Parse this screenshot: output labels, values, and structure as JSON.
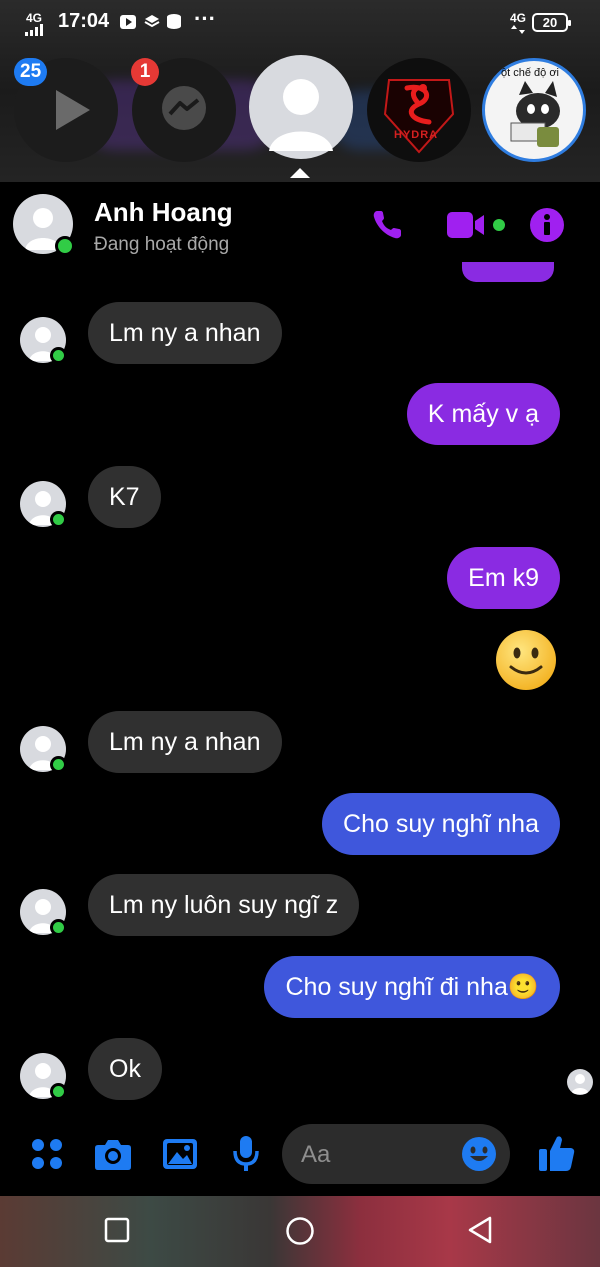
{
  "status_bar": {
    "network_left": "4G",
    "time": "17:04",
    "menu_dots": "···",
    "network_right": "4G",
    "battery": "20"
  },
  "chat_heads": {
    "badge_first": "25",
    "badge_second": "1",
    "hydra_text": "HYDRA",
    "sticker_text": "ột chế độ ơi"
  },
  "header": {
    "name": "Anh Hoang",
    "status": "Đang hoạt động",
    "accent_color": "#a020f0"
  },
  "messages": [
    {
      "side": "in",
      "text": "Lm ny a nhan"
    },
    {
      "side": "out",
      "color": "purple",
      "text": "K mấy v ạ"
    },
    {
      "side": "in",
      "text": "K7"
    },
    {
      "side": "out",
      "color": "purple",
      "text": "Em k9"
    },
    {
      "side": "out",
      "emoji": "slightly-smiling-face"
    },
    {
      "side": "in",
      "text": "Lm ny a nhan"
    },
    {
      "side": "out",
      "color": "blue",
      "text": "Cho suy nghĩ nha"
    },
    {
      "side": "in",
      "text": "Lm ny luôn suy ngĩ z"
    },
    {
      "side": "out",
      "color": "blue",
      "text": "Cho suy nghĩ đi nha🙂"
    },
    {
      "side": "in",
      "text": "Ok"
    }
  ],
  "composer": {
    "placeholder": "Aa",
    "icons": [
      "apps-icon",
      "camera-icon",
      "gallery-icon",
      "microphone-icon",
      "emoji-icon",
      "thumbs-up-icon"
    ],
    "accent_color": "#1e7bf2"
  },
  "colors": {
    "incoming_bubble": "#303030",
    "outgoing_purple": "#8a2be2",
    "outgoing_blue": "#3f57dc",
    "online_dot": "#31cc46"
  }
}
